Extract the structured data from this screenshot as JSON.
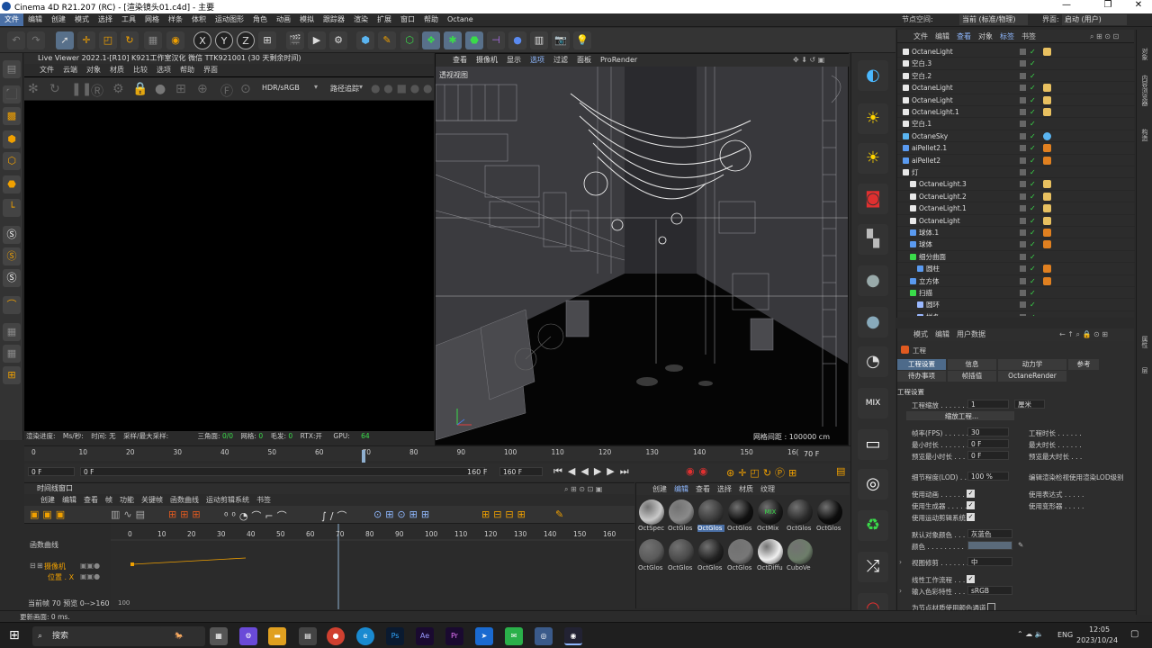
{
  "window": {
    "title": "Cinema 4D R21.207 (RC) - [渲染镜头01.c4d] - 主要",
    "controls": [
      "—",
      "❐",
      "✕"
    ]
  },
  "menubar": {
    "items": [
      "文件",
      "编辑",
      "创建",
      "模式",
      "选择",
      "工具",
      "网格",
      "样条",
      "体积",
      "运动图形",
      "角色",
      "动画",
      "模拟",
      "跟踪器",
      "渲染",
      "扩展",
      "窗口",
      "帮助",
      "Octane"
    ],
    "node_space_label": "节点空间:",
    "node_space_value": "当前 (标准/物理)",
    "interface_label": "界面:",
    "interface_value": "启动 (用户)"
  },
  "toolbar": {
    "icons": [
      "undo-icon",
      "redo-icon",
      "select-icon",
      "move-icon",
      "scale-icon",
      "rotate-icon",
      "grid-icon",
      "live-select-icon",
      "x-axis-icon",
      "y-axis-icon",
      "z-axis-icon",
      "coord-icon",
      "render-view-icon",
      "render-icon",
      "render-settings-icon",
      "cube-icon",
      "pen-icon",
      "subdivision-icon",
      "cloner-icon",
      "effector-icon",
      "mograph-icon",
      "deformer-icon",
      "scene-icon",
      "camera-icon",
      "light-icon"
    ],
    "axis_labels": [
      "X",
      "Y",
      "Z"
    ]
  },
  "live_viewer": {
    "title": "Live Viewer 2022.1-[R10]  K921工作室汉化  微信  TTK921001 (30 天剩余时间)",
    "menu": [
      "文件",
      "云端",
      "对象",
      "材质",
      "比较",
      "选项",
      "帮助",
      "界面"
    ],
    "color_mode": "HDR/sRGB",
    "tracing_mode": "路径追踪",
    "status": "渲染进度:    Ms/秒:    时间: 无    采样/最大采样: 无    三角面: 0/0    网格: 0    毛发: 0    RTX:开    GPU:   64",
    "status_parts": [
      "渲染进度:",
      "Ms/秒:",
      "时间: 无",
      "采样/最大采样:",
      "三角面:",
      "0/0",
      "网格:",
      "0",
      "毛发:",
      "0",
      "RTX:开",
      "GPU:",
      "64"
    ]
  },
  "viewport": {
    "menu": [
      "查看",
      "摄像机",
      "显示",
      "选项",
      "过滤",
      "面板",
      "ProRender"
    ],
    "label": "透视视图",
    "grid_spacing": "网格间距 : 100000 cm"
  },
  "timeline": {
    "ticks": [
      "0",
      "10",
      "20",
      "30",
      "40",
      "50",
      "60",
      "70",
      "80",
      "90",
      "100",
      "110",
      "120",
      "130",
      "140",
      "150",
      "16("
    ],
    "current_frame_display": "70 F",
    "current": 70,
    "max": 160,
    "start_field": "0 F",
    "range_field": "0 F",
    "end_field": "160 F",
    "end_field2": "160 F"
  },
  "timeline_window": {
    "title": "时间线窗口",
    "menu": [
      "创建",
      "编辑",
      "查看",
      "帧",
      "功能",
      "关键帧",
      "函数曲线",
      "运动剪辑系统",
      "书签"
    ],
    "section_label": "函数曲线",
    "track_object": "摄像机",
    "track_param": "位置 . X",
    "ticks": [
      "0",
      "10",
      "20",
      "30",
      "40",
      "50",
      "60",
      "70",
      "80",
      "90",
      "100",
      "110",
      "120",
      "130",
      "140",
      "150",
      "160"
    ],
    "bottom_label": "100",
    "footer": "当前帧  70   预览   0-->160"
  },
  "materials": {
    "menu": [
      "创建",
      "编辑",
      "查看",
      "选择",
      "材质",
      "纹理"
    ],
    "items": [
      {
        "name": "OctSpec",
        "color": "#c9c9c9"
      },
      {
        "name": "OctGlos",
        "color": "#8a8a8a"
      },
      {
        "name": "OctGlos",
        "color": "#3a3a3a"
      },
      {
        "name": "OctGlos",
        "color": "#111111"
      },
      {
        "name": "OctMix",
        "color": "#1a1a1a"
      },
      {
        "name": "OctGlos",
        "color": "#2a2a2a"
      },
      {
        "name": "OctGlos",
        "color": "#0d0d0d"
      },
      {
        "name": "OctGlos",
        "color": "#5a5a5a"
      },
      {
        "name": "OctGlos",
        "color": "#4a4a4a"
      },
      {
        "name": "OctGlos",
        "color": "#222222"
      },
      {
        "name": "OctGlos",
        "color": "#777777"
      },
      {
        "name": "OctDiffu",
        "color": "#f0f0f0"
      },
      {
        "name": "CuboVe",
        "color": "#6d7d6a"
      }
    ],
    "mix_label": "MIX"
  },
  "objects": {
    "menu": [
      "文件",
      "编辑",
      "查看",
      "对象",
      "标签",
      "书签"
    ],
    "rows": [
      {
        "name": "OctaneLight",
        "indent": 0,
        "type": "light"
      },
      {
        "name": "空白.3",
        "indent": 0,
        "type": "null"
      },
      {
        "name": "空白.2",
        "indent": 0,
        "type": "null"
      },
      {
        "name": "OctaneLight",
        "indent": 0,
        "type": "light"
      },
      {
        "name": "OctaneLight",
        "indent": 0,
        "type": "light"
      },
      {
        "name": "OctaneLight.1",
        "indent": 0,
        "type": "light"
      },
      {
        "name": "空白.1",
        "indent": 0,
        "type": "null"
      },
      {
        "name": "OctaneSky",
        "indent": 0,
        "type": "sky"
      },
      {
        "name": "aiPellet2.1",
        "indent": 0,
        "type": "geo"
      },
      {
        "name": "aiPellet2",
        "indent": 0,
        "type": "geo"
      },
      {
        "name": "灯",
        "indent": 0,
        "type": "group"
      },
      {
        "name": "OctaneLight.3",
        "indent": 1,
        "type": "light"
      },
      {
        "name": "OctaneLight.2",
        "indent": 1,
        "type": "light"
      },
      {
        "name": "OctaneLight.1",
        "indent": 1,
        "type": "light"
      },
      {
        "name": "OctaneLight",
        "indent": 1,
        "type": "light"
      },
      {
        "name": "球体.1",
        "indent": 1,
        "type": "geo"
      },
      {
        "name": "球体",
        "indent": 1,
        "type": "geo"
      },
      {
        "name": "细分曲面",
        "indent": 1,
        "type": "sub"
      },
      {
        "name": "圆柱",
        "indent": 2,
        "type": "geo"
      },
      {
        "name": "立方体",
        "indent": 1,
        "type": "geo"
      },
      {
        "name": "扫描",
        "indent": 1,
        "type": "sub"
      },
      {
        "name": "圆环",
        "indent": 2,
        "type": "spline"
      },
      {
        "name": "样条",
        "indent": 2,
        "type": "spline"
      }
    ]
  },
  "attributes": {
    "menu": [
      "模式",
      "编辑",
      "用户数据"
    ],
    "object": "工程",
    "tabs_row1": [
      "工程设置",
      "信息",
      "动力学",
      "参考"
    ],
    "tabs_row2": [
      "待办事项",
      "帧插值",
      "OctaneRender"
    ],
    "section": "工程设置",
    "scale_label": "工程缩放 . . . . . . .",
    "scale_value": "1",
    "scale_unit": "厘米",
    "scale_button": "缩放工程...",
    "fps_label": "帧率(FPS) . . . . . . .",
    "fps_value": "30",
    "project_length_label": "工程时长 . . . . . .",
    "min_length_label": "最小时长 . . . . . . .",
    "min_length_value": "0 F",
    "max_length_label": "最大时长 . . . . . .",
    "preview_min_label": "预览最小时长 . . .",
    "preview_min_value": "0 F",
    "preview_max_label": "预览最大时长 . . .",
    "lod_label": "细节程度(LOD) . . .",
    "lod_value": "100 %",
    "lod_render_label": "编辑渲染检视使用渲染LOD级别",
    "use_anim_label": "使用动画 . . . . . . .",
    "use_expr_label": "使用表达式 . . . . .",
    "use_gen_label": "使用生成器 . . . . .",
    "use_deform_label": "使用变形器 . . . . .",
    "use_motion_label": "使用运动剪辑系统",
    "default_color_label": "默认对象颜色 . . .",
    "default_color_value": "灰蓝色",
    "color_label": "颜色 . . . . . . . . .",
    "view_clip_label": "视图修剪 . . . . . . .",
    "view_clip_value": "中",
    "linear_label": "线性工作流程 . . . .",
    "input_color_label": "输入色彩特性 . . . .",
    "input_color_value": "sRGB",
    "node_color_label": "为节点材质使用颜色通道"
  },
  "right_strip": {
    "mix_label": "MIX",
    "icons": [
      "octane-half-icon",
      "sun-icon",
      "sun-icon",
      "camera-icon",
      "tool-icon",
      "sphere-icon",
      "sphere-icon",
      "pie-icon",
      "mix-icon",
      "rect-light-icon",
      "ring-icon",
      "recycle-icon",
      "shuffle-icon"
    ]
  },
  "right_vtabs": [
    "对象",
    "内容浏览器",
    "构造"
  ],
  "right_vtabs2": [
    "属性",
    "层"
  ],
  "status_bar": "更新画面: 0 ms.",
  "taskbar": {
    "search": "搜索",
    "apps": [
      "task-view",
      "calc",
      "settings",
      "notes",
      "chrome",
      "edge",
      "explorer",
      "ps",
      "ae",
      "pr",
      "files",
      "wechat",
      "c4d-a",
      "c4d-b"
    ],
    "app_labels": [
      "Ps",
      "Ae",
      "Pr"
    ],
    "language": "ENG",
    "time": "12:05",
    "date": "2023/10/24"
  },
  "colors": {
    "accent": "#4a6fa5",
    "check": "#3adb4a",
    "tag_orange": "#f0a000"
  }
}
